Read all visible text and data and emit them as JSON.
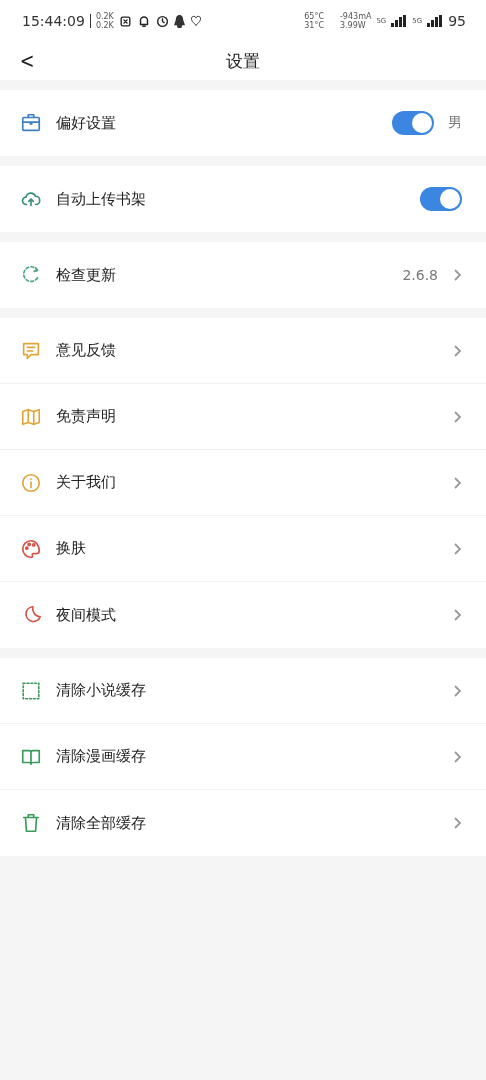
{
  "status_bar": {
    "time": "15:44:09",
    "net_up": "0.2K",
    "net_down": "0.2K",
    "temp_1": "65°C",
    "temp_2": "31°C",
    "current": "-943mA",
    "power": "3.99W",
    "sim_1": "5G",
    "sim_2": "5G",
    "battery": "95"
  },
  "header": {
    "back": "<",
    "title": "设置"
  },
  "sections": [
    {
      "items": [
        {
          "kind": "toggle",
          "label": "偏好设置",
          "on": true,
          "value": "男"
        }
      ]
    },
    {
      "items": [
        {
          "kind": "toggle",
          "label": "自动上传书架",
          "on": true
        }
      ]
    },
    {
      "items": [
        {
          "kind": "link",
          "label": "检查更新",
          "value": "2.6.8"
        }
      ]
    },
    {
      "items": [
        {
          "kind": "link",
          "label": "意见反馈"
        },
        {
          "kind": "link",
          "label": "免责声明"
        },
        {
          "kind": "link",
          "label": "关于我们"
        },
        {
          "kind": "link",
          "label": "换肤"
        },
        {
          "kind": "link",
          "label": "夜间模式"
        }
      ]
    },
    {
      "items": [
        {
          "kind": "link",
          "label": "清除小说缓存"
        },
        {
          "kind": "link",
          "label": "清除漫画缓存"
        },
        {
          "kind": "link",
          "label": "清除全部缓存"
        }
      ]
    }
  ]
}
